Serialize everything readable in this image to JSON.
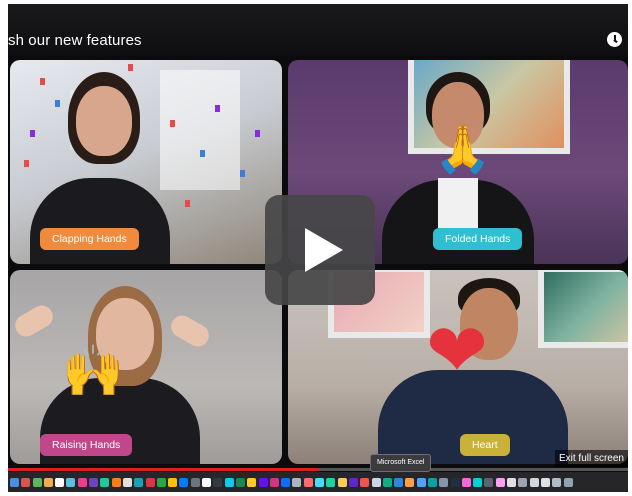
{
  "video": {
    "title": "sh our new features",
    "exit_label": "Exit full screen",
    "progress": 0.5
  },
  "tiles": [
    {
      "label": "Clapping Hands",
      "tag_color": "#f08a3c",
      "emoji": ""
    },
    {
      "label": "Folded Hands",
      "tag_color": "#2fbfd0",
      "emoji": "🙏"
    },
    {
      "label": "Raising Hands",
      "tag_color": "#c0478a",
      "emoji": "🙌"
    },
    {
      "label": "Heart",
      "tag_color": "#c9b13a",
      "emoji": "❤"
    }
  ],
  "play_button": {
    "icon": "play-icon"
  },
  "clock_icon": "clock-icon",
  "dock": {
    "tooltip": "Microsoft Excel",
    "icon_colors": [
      "#4a90e2",
      "#d9534f",
      "#5cb85c",
      "#f0ad4e",
      "#ffffff",
      "#5bc0de",
      "#e83e8c",
      "#6f42c1",
      "#20c997",
      "#fd7e14",
      "#e0e0e0",
      "#17a2b8",
      "#dc3545",
      "#28a745",
      "#ffc107",
      "#007bff",
      "#6c757d",
      "#f8f9fa",
      "#343a40",
      "#0dcaf0",
      "#198754",
      "#ffca2c",
      "#6610f2",
      "#d63384",
      "#0d6efd",
      "#adb5bd",
      "#ff6b6b",
      "#48dbfb",
      "#1dd1a1",
      "#feca57",
      "#5f27cd",
      "#ee5253",
      "#c8d6e5",
      "#10ac84",
      "#2e86de",
      "#ff9f43",
      "#54a0ff",
      "#01a3a4",
      "#8395a7",
      "#222f3e",
      "#f368e0",
      "#00d2d3",
      "#576574",
      "#ff9ff3",
      "#e0e0e0",
      "#9aa5b1",
      "#cfd8dc",
      "#e0e0e0",
      "#b0bec5",
      "#90a4ae"
    ]
  }
}
